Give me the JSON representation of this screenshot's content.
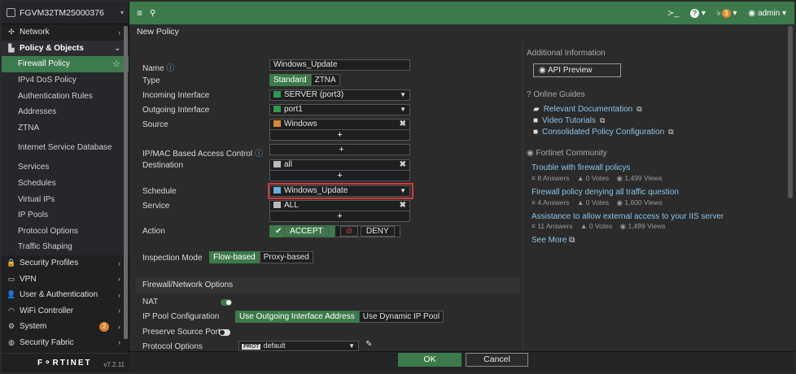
{
  "device": {
    "name": "FGVM32TM25000376"
  },
  "sidebar": {
    "items": [
      {
        "label": "Network",
        "icon": "network-icon",
        "glyph": "✣",
        "chev": "›",
        "cls": ""
      },
      {
        "label": "Policy & Objects",
        "icon": "policy-icon",
        "glyph": "▙",
        "chev": "⌄",
        "cls": "parent strong"
      },
      {
        "label": "Firewall Policy",
        "cls": "sub active",
        "star": "☆"
      },
      {
        "label": "IPv4 DoS Policy",
        "cls": "sub"
      },
      {
        "label": "Authentication Rules",
        "cls": "sub"
      },
      {
        "label": "Addresses",
        "cls": "sub"
      },
      {
        "label": "ZTNA",
        "cls": "sub"
      },
      {
        "label": "Internet Service Database",
        "cls": "sub2"
      },
      {
        "label": "Services",
        "cls": "sub"
      },
      {
        "label": "Schedules",
        "cls": "sub"
      },
      {
        "label": "Virtual IPs",
        "cls": "sub"
      },
      {
        "label": "IP Pools",
        "cls": "sub"
      },
      {
        "label": "Protocol Options",
        "cls": "sub"
      },
      {
        "label": "Traffic Shaping",
        "cls": "sub"
      },
      {
        "label": "Security Profiles",
        "icon": "lock-icon",
        "glyph": "🔒",
        "chev": "›",
        "cls": ""
      },
      {
        "label": "VPN",
        "icon": "monitor-icon",
        "glyph": "▭",
        "chev": "›",
        "cls": ""
      },
      {
        "label": "User & Authentication",
        "icon": "user-icon",
        "glyph": "👤",
        "chev": "›",
        "cls": ""
      },
      {
        "label": "WiFi Controller",
        "icon": "wifi-icon",
        "glyph": "◠",
        "chev": "›",
        "cls": ""
      },
      {
        "label": "System",
        "icon": "gear-icon",
        "glyph": "⚙",
        "chev": "›",
        "cls": "",
        "badge": "2"
      },
      {
        "label": "Security Fabric",
        "icon": "fabric-icon",
        "glyph": "◍",
        "chev": "›",
        "cls": ""
      }
    ],
    "brand": "F⚬RTINET",
    "version": "v7.2.11"
  },
  "topbar": {
    "menu_icon": "≡",
    "search_icon": "🔍",
    "cli_icon": "≻_",
    "help": "?",
    "bell": "🔔",
    "notif_count": "3",
    "user": "admin"
  },
  "page": {
    "title": "New Policy"
  },
  "form": {
    "name_label": "Name",
    "name_value": "Windows_Update",
    "type_label": "Type",
    "type_options": [
      "Standard",
      "ZTNA"
    ],
    "incoming_label": "Incoming Interface",
    "incoming_value": "SERVER (port3)",
    "outgoing_label": "Outgoing Interface",
    "outgoing_value": "port1",
    "source_label": "Source",
    "source_value": "Windows",
    "ipmac_label": "IP/MAC Based Access Control",
    "destination_label": "Destination",
    "destination_value": "all",
    "schedule_label": "Schedule",
    "schedule_value": "Windows_Update",
    "service_label": "Service",
    "service_value": "ALL",
    "action_label": "Action",
    "accept": "ACCEPT",
    "deny": "DENY",
    "inspection_label": "Inspection Mode",
    "inspection_options": [
      "Flow-based",
      "Proxy-based"
    ],
    "section_title": "Firewall/Network Options",
    "nat_label": "NAT",
    "ippool_label": "IP Pool Configuration",
    "ippool_options": [
      "Use Outgoing Interface Address",
      "Use Dynamic IP Pool"
    ],
    "preserve_label": "Preserve Source Port",
    "protocol_label": "Protocol Options",
    "protocol_tag": "PROT",
    "protocol_value": "default"
  },
  "buttons": {
    "ok": "OK",
    "cancel": "Cancel"
  },
  "right": {
    "additional_info": "Additional Information",
    "api_preview": "API Preview",
    "online_guides": "Online Guides",
    "guides": [
      {
        "label": "Relevant Documentation",
        "icon": "book-icon",
        "glyph": "▰"
      },
      {
        "label": "Video Tutorials",
        "icon": "video-icon",
        "glyph": "■"
      },
      {
        "label": "Consolidated Policy Configuration",
        "icon": "video-icon",
        "glyph": "■"
      }
    ],
    "community": "Fortinet Community",
    "questions": [
      {
        "title": "Trouble with firewall policys",
        "answers": "8 Answers",
        "votes": "0 Votes",
        "views": "1,499 Views"
      },
      {
        "title": "Firewall policy denying all traffic question",
        "answers": "4 Answers",
        "votes": "0 Votes",
        "views": "1,600 Views"
      },
      {
        "title": "Assistance to allow external access to your IIS server",
        "answers": "11 Answers",
        "votes": "0 Votes",
        "views": "1,499 Views"
      }
    ],
    "see_more": "See More"
  }
}
